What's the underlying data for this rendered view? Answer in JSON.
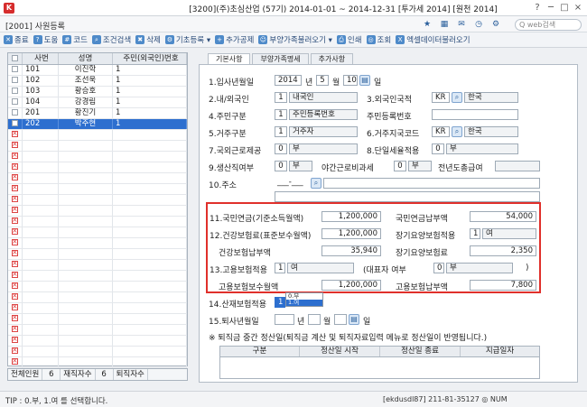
{
  "titlebar": {
    "title": "[3200](주)초심산업 (57기) 2014-01-01 ~ 2014-12-31 [투가세 2014] [원천 2014]",
    "help": "?",
    "minimize": "─",
    "maximize": "□",
    "close": "×"
  },
  "header": {
    "window_label": "[2001] 사원등록",
    "search_placeholder": "Q web검색"
  },
  "toolbar": {
    "buttons": [
      {
        "icon": "close-icon",
        "label": "종료"
      },
      {
        "icon": "help-icon",
        "label": "도움"
      },
      {
        "icon": "code-icon",
        "label": "코드"
      },
      {
        "icon": "search-icon",
        "label": "조건검색"
      },
      {
        "icon": "delete-icon",
        "label": "삭제"
      },
      {
        "icon": "settings-icon",
        "label": "기초등록 ▾"
      },
      {
        "icon": "add-icon",
        "label": "추가공제"
      },
      {
        "icon": "family-icon",
        "label": "부양가족불러오기 ▾"
      },
      {
        "icon": "print-icon",
        "label": "인쇄"
      },
      {
        "icon": "query-icon",
        "label": "조회"
      },
      {
        "icon": "excel-icon",
        "label": "엑셀데이터불러오기"
      }
    ]
  },
  "employee_list": {
    "columns": [
      "",
      "사번",
      "성명",
      "주민(외국인)번호"
    ],
    "rows": [
      {
        "code": "101",
        "name": "이진학",
        "type": "1",
        "selected": false,
        "deleted": false
      },
      {
        "code": "102",
        "name": "조선욱",
        "type": "1",
        "selected": false,
        "deleted": false
      },
      {
        "code": "103",
        "name": "황승호",
        "type": "1",
        "selected": false,
        "deleted": false
      },
      {
        "code": "104",
        "name": "강경림",
        "type": "1",
        "selected": false,
        "deleted": false
      },
      {
        "code": "201",
        "name": "황진기",
        "type": "1",
        "selected": false,
        "deleted": false
      },
      {
        "code": "202",
        "name": "박주현",
        "type": "1",
        "selected": true,
        "deleted": false
      }
    ],
    "empty_rows": 22,
    "footer": {
      "total_label": "전체인원",
      "total_value": "6",
      "active_label": "재직자수",
      "active_value": "6",
      "retired_label": "퇴직자수",
      "retired_value": ""
    }
  },
  "tabs": [
    "기본사항",
    "부양가족명세",
    "추가사항"
  ],
  "form": {
    "hire_date_label": "1.입사년월일",
    "hire_year": "2014",
    "year_unit": "년",
    "hire_month": "5",
    "month_unit": "월",
    "hire_day": "10",
    "day_unit": "일",
    "domestic_label": "2.내/외국인",
    "domestic_code": "1",
    "domestic_value": "내국인",
    "foreign_country_label": "3.외국인국적",
    "foreign_country_code": "KR",
    "foreign_country_value": "한국",
    "id_type_label": "4.주민구분",
    "id_type_code": "1",
    "id_type_value": "주민등록번호",
    "id_number_label": "주민등록번호",
    "residence_label": "5.거주구분",
    "residence_code": "1",
    "residence_value": "거주자",
    "residence_country_label": "6.거주지국코드",
    "residence_country_code": "KR",
    "residence_country_value": "한국",
    "foreign_worker_label": "7.국외근로제공",
    "foreign_worker_code": "0",
    "foreign_worker_value": "부",
    "single_tax_label": "8.단일세율적용",
    "single_tax_code": "0",
    "single_tax_value": "부",
    "production_label": "9.생산직여부",
    "production_code": "0",
    "production_value": "부",
    "overtime_label": "야간근로비과세",
    "overtime_code": "0",
    "overtime_value": "부",
    "prev_year_label": "전년도총급여",
    "address_label": "10.주소",
    "postal": "___-___"
  },
  "insurance": {
    "pension_label": "11.국민연금(기준소득월액)",
    "pension_value": "1,200,000",
    "pension_pay_label": "국민연금납부액",
    "pension_pay_value": "54,000",
    "health_label": "12.건강보험료(표준보수월액)",
    "health_value": "1,200,000",
    "ltc_apply_label": "장기요양보험적용",
    "ltc_apply_code": "1",
    "ltc_apply_value": "여",
    "health_pay_label": "건강보험납부액",
    "health_pay_value": "35,940",
    "ltc_pay_label": "장기요양보험료",
    "ltc_pay_value": "2,350",
    "employ_label": "13.고용보험적용",
    "employ_code": "1",
    "employ_value": "여",
    "rep_label": "(대표자 여부",
    "rep_code": "0",
    "rep_value": "부",
    "rep_close": ")",
    "employ_monthly_label": "고용보험보수월액",
    "employ_monthly_value": "1,200,000",
    "employ_pay_label": "고용보험납부액",
    "employ_pay_value": "7,800"
  },
  "lower": {
    "industrial_label": "14.산재보험적용",
    "industrial_code": "1",
    "dropdown_options": [
      "0.부",
      "1.여"
    ],
    "retire_label": "15.퇴사년월일",
    "retire_year_unit": "년",
    "retire_month_unit": "월",
    "retire_day_unit": "일",
    "note": "※ 퇴직금 중간 정산일(퇴직금 계산 및 퇴직자료입력 메뉴로 정산일이 반영됩니다.)",
    "settle_columns": [
      "구분",
      "정산일 시작",
      "정산일 종료",
      "지급일자"
    ]
  },
  "status": {
    "tip": "TIP : 0.부, 1.여 를 선택합니다.",
    "right": "[ekdusdl87] 211-81-35127  ◎  NUM"
  }
}
